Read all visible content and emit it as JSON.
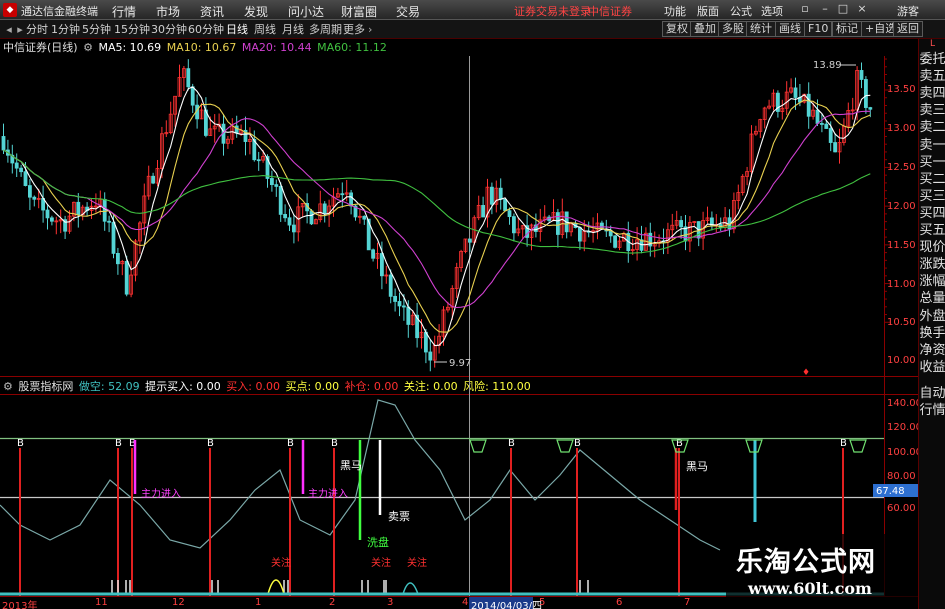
{
  "app": {
    "title": "通达信金融终端",
    "menu": [
      "行情",
      "市场",
      "资讯",
      "发现",
      "问小达",
      "财富圈",
      "交易"
    ],
    "status_text": "证券交易未登录",
    "broker": "中信证券",
    "right_menu": [
      "功能",
      "版面",
      "公式",
      "选项"
    ],
    "user": "游客"
  },
  "toolbar": {
    "periods": [
      "分时",
      "1分钟",
      "5分钟",
      "15分钟",
      "30分钟",
      "60分钟",
      "日线",
      "周线",
      "月线",
      "多周期",
      "更多"
    ],
    "active_period": "日线",
    "right_buttons": [
      "复权",
      "叠加",
      "多股",
      "统计",
      "画线",
      "F10",
      "标记",
      "+自选",
      "返回"
    ]
  },
  "main_panel": {
    "stock": "中信证券(日线)",
    "ma": [
      {
        "label": "MA5: 10.69",
        "color": "#ffffff"
      },
      {
        "label": "MA10: 10.67",
        "color": "#e8d050"
      },
      {
        "label": "MA20: 10.44",
        "color": "#d040d0"
      },
      {
        "label": "MA60: 11.12",
        "color": "#40c040"
      }
    ],
    "y_ticks": [
      "13.50",
      "13.00",
      "12.50",
      "12.00",
      "11.50",
      "11.00",
      "10.50",
      "10.00"
    ],
    "high_label": "13.89",
    "low_label": "9.97"
  },
  "indicator_panel": {
    "name": "股票指标网",
    "fields": [
      {
        "label": "做空: 52.09",
        "color": "#40c0c0"
      },
      {
        "label": "提示买入: 0.00",
        "color": "#ffffff"
      },
      {
        "label": "买入: 0.00",
        "color": "#ff3030"
      },
      {
        "label": "买点: 0.00",
        "color": "#ffff40"
      },
      {
        "label": "补仓: 0.00",
        "color": "#ff3030"
      },
      {
        "label": "关注: 0.00",
        "color": "#ffff40"
      },
      {
        "label": "风险: 110.00",
        "color": "#ffff40"
      }
    ],
    "y_ticks": [
      "140.00",
      "120.00",
      "100.00",
      "80.00",
      "60.00"
    ],
    "current_value": "67.48",
    "annotations": {
      "heima": "黑马",
      "maichu": "卖票",
      "xipan": "洗盘",
      "guanzhu": "关注",
      "zhuli": "主力进入",
      "b": "B"
    }
  },
  "x_axis": [
    "2013年",
    "11",
    "12",
    "1",
    "2",
    "3",
    "4",
    "2014/04/03/四",
    "5",
    "6",
    "7"
  ],
  "side_tabs": [
    "委托",
    "卖五",
    "卖四",
    "卖三",
    "卖二",
    "卖一",
    "买一",
    "买二",
    "买三",
    "买四",
    "买五",
    "现价",
    "涨跌",
    "涨幅",
    "总量",
    "外盘",
    "换手",
    "净资",
    "收益"
  ],
  "side_tabs2": [
    "自动",
    "行情"
  ],
  "watermark": {
    "line1": "乐淘公式网",
    "line2": "www.60lt.com"
  }
}
